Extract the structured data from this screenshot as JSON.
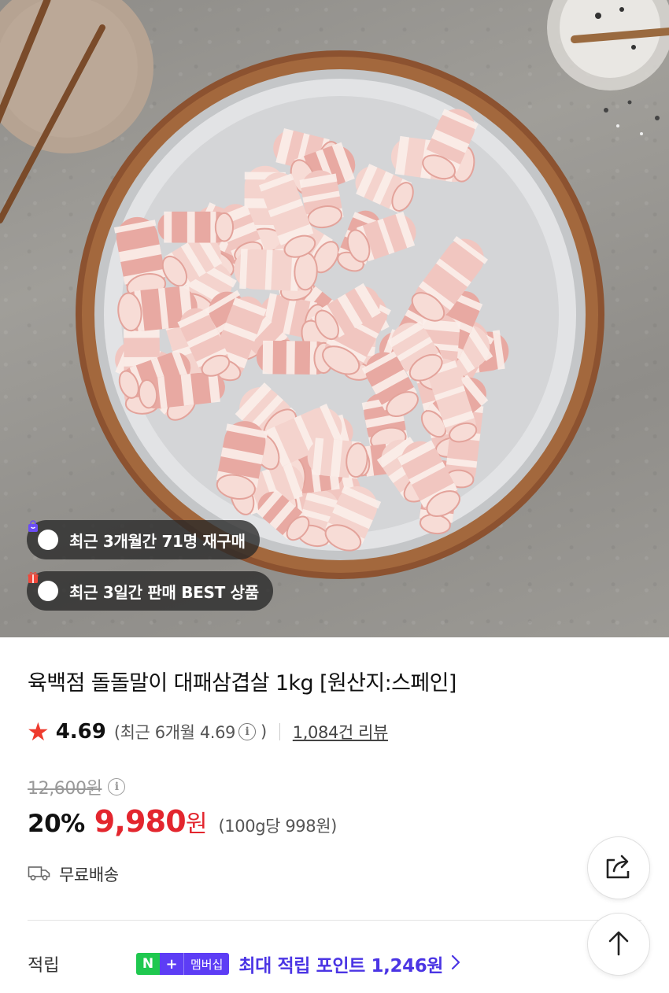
{
  "product": {
    "image_alt": "dolldol-mari pork belly rolls on a plate",
    "badges": [
      {
        "icon": "shopping-bag-icon",
        "text": "최근 3개월간 71명 재구매",
        "color": "#6b4cf6"
      },
      {
        "icon": "gift-box-icon",
        "text": "최근 3일간 판매 BEST 상품",
        "color": "#f0473a"
      }
    ],
    "title": "육백점 돌돌말이 대패삼겹살 1kg [원산지:스페인]",
    "rating": {
      "value": "4.69",
      "recent_label": "(최근 6개월 4.69",
      "recent_close": ")",
      "reviews": "1,084건 리뷰"
    },
    "price": {
      "original": "12,600원",
      "discount": "20%",
      "sale": "9,980",
      "currency": "원",
      "unit_price": "(100g당 998원)"
    },
    "shipping": "무료배송",
    "points": {
      "label": "적립",
      "badge_n": "N",
      "badge_plus": "+",
      "badge_membership": "멤버십",
      "text": "최대 적립 포인트 1,246원"
    }
  },
  "colors": {
    "price_red": "#e3262e",
    "star_red": "#ee3b2e",
    "points_purple": "#4b35e4",
    "naver_green": "#1fc84f"
  }
}
